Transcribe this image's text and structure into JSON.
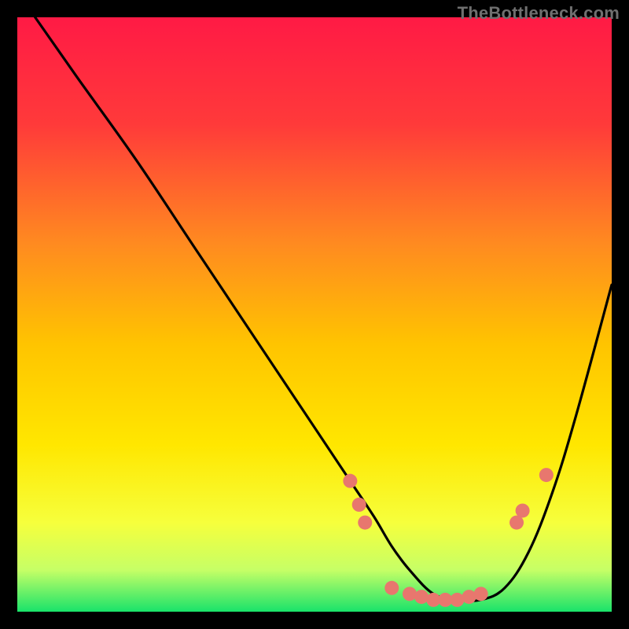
{
  "watermark": "TheBottleneck.com",
  "chart_data": {
    "type": "line",
    "title": "",
    "xlabel": "",
    "ylabel": "",
    "xlim": [
      0,
      100
    ],
    "ylim": [
      0,
      100
    ],
    "background_gradient": {
      "top_color": "#ff1a45",
      "mid_top_color": "#ff6a2e",
      "mid_color": "#ffd400",
      "mid_low_color": "#f6ff3c",
      "low_color": "#19e36a"
    },
    "series": [
      {
        "name": "bottleneck-curve",
        "color": "#000000",
        "x": [
          3,
          10,
          20,
          30,
          40,
          50,
          56,
          60,
          63,
          66,
          70,
          74,
          78,
          82,
          86,
          90,
          94,
          100
        ],
        "y": [
          100,
          90,
          76,
          61,
          46,
          31,
          22,
          16,
          11,
          7,
          3,
          2,
          2,
          4,
          10,
          20,
          33,
          55
        ]
      }
    ],
    "markers": {
      "name": "highlight-points",
      "color": "#e8776e",
      "radius": 9,
      "points": [
        {
          "x": 56,
          "y": 22
        },
        {
          "x": 57.5,
          "y": 18
        },
        {
          "x": 58.5,
          "y": 15
        },
        {
          "x": 63,
          "y": 4
        },
        {
          "x": 66,
          "y": 3
        },
        {
          "x": 68,
          "y": 2.5
        },
        {
          "x": 70,
          "y": 2
        },
        {
          "x": 72,
          "y": 2
        },
        {
          "x": 74,
          "y": 2
        },
        {
          "x": 76,
          "y": 2.5
        },
        {
          "x": 78,
          "y": 3
        },
        {
          "x": 84,
          "y": 15
        },
        {
          "x": 85,
          "y": 17
        },
        {
          "x": 89,
          "y": 23
        }
      ]
    }
  }
}
